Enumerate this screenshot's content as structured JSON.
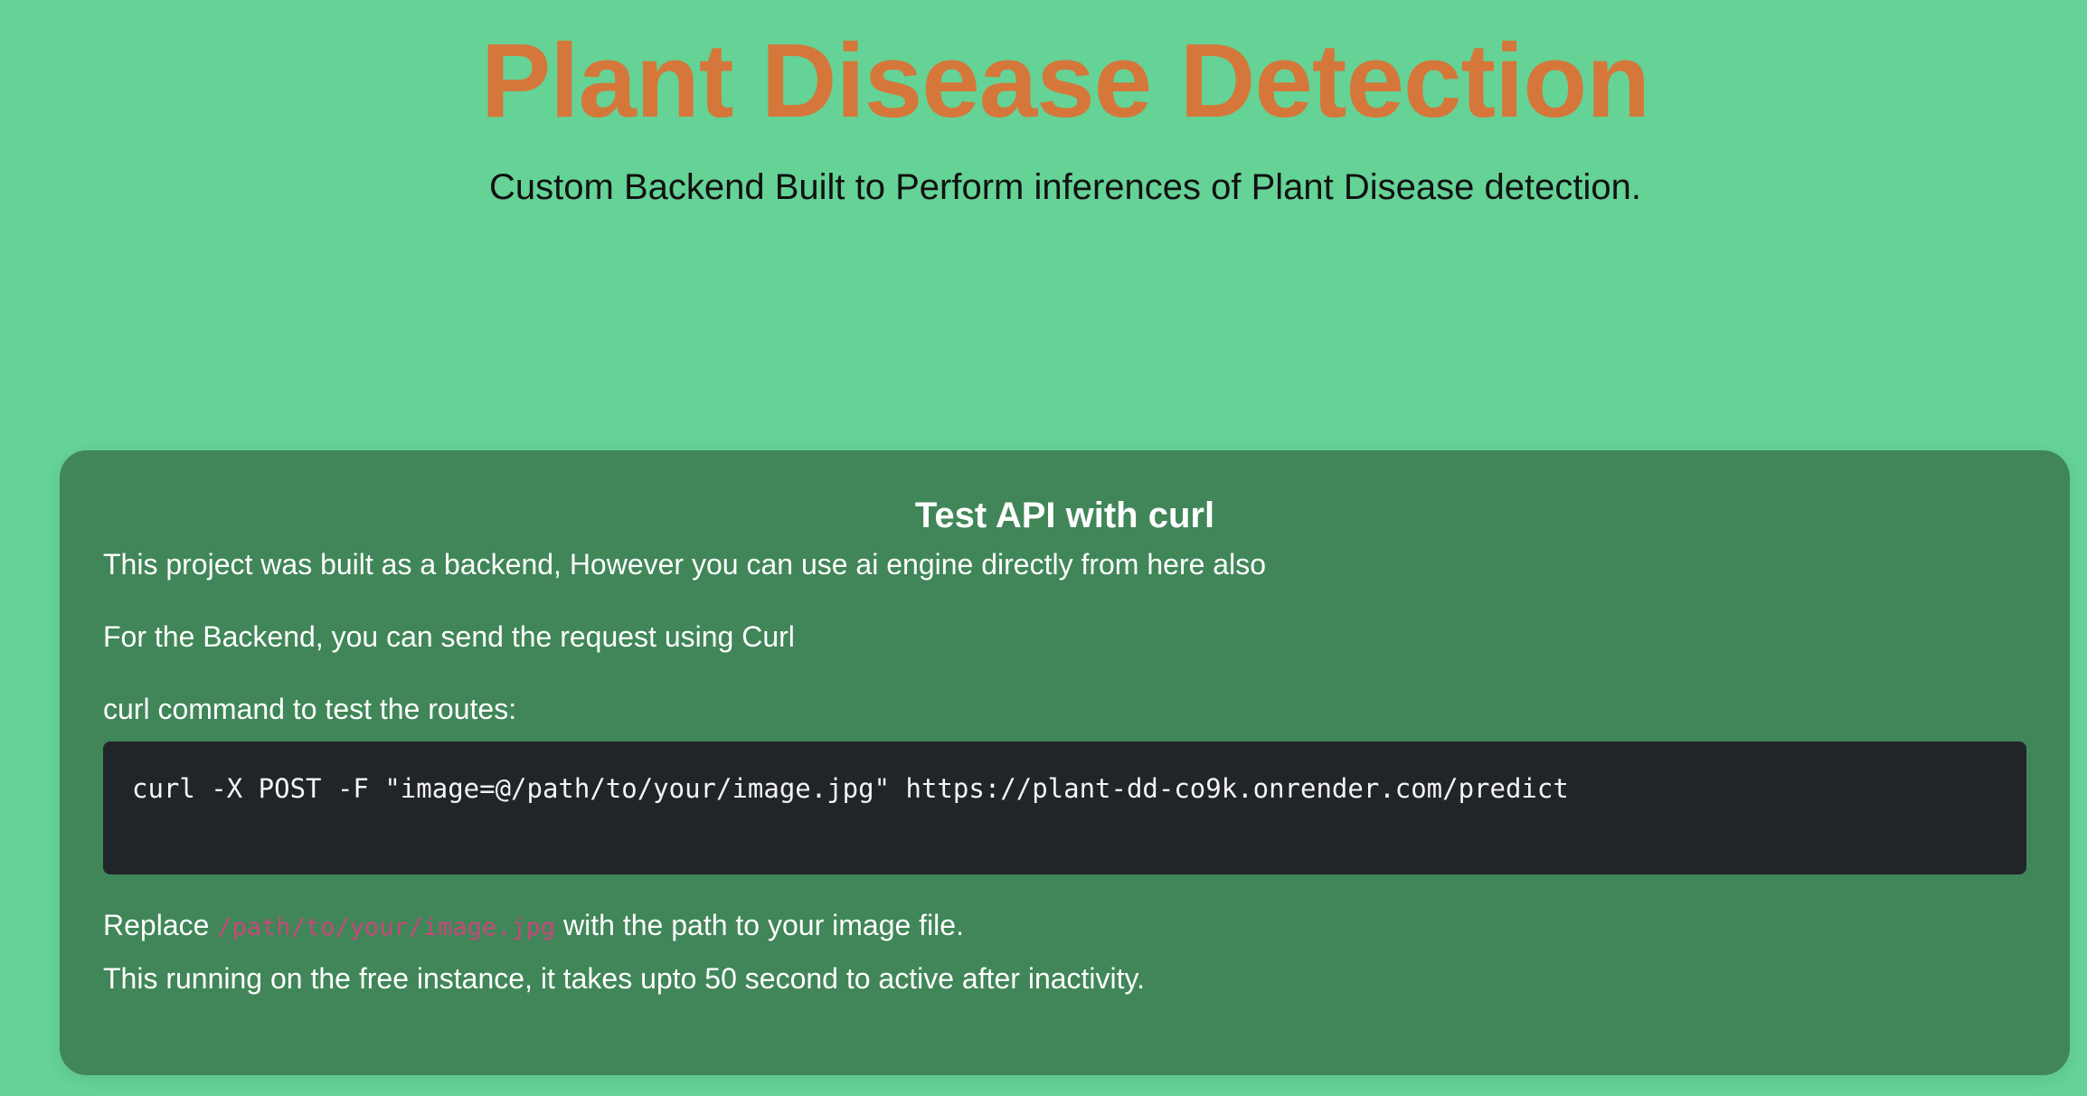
{
  "header": {
    "title": "Plant Disease Detection",
    "subtitle": "Custom Backend Built to Perform inferences of Plant Disease detection."
  },
  "card": {
    "title": "Test API with curl",
    "intro": "This project was built as a backend, However you can use ai engine directly from here also",
    "backend_note": "For the Backend, you can send the request using Curl",
    "command_label": "curl command to test the routes:",
    "command": "curl -X POST -F \"image=@/path/to/your/image.jpg\" https://plant-dd-co9k.onrender.com/predict",
    "replace_prefix": "Replace ",
    "replace_path": "/path/to/your/image.jpg",
    "replace_suffix": " with the path to your image file.",
    "instance_note": "This running on the free instance, it takes upto 50 second to active after inactivity."
  },
  "colors": {
    "background": "#65d296",
    "title": "#d5773a",
    "card": "#408658",
    "code_bg": "#212429",
    "inline_code": "#c8487a"
  }
}
